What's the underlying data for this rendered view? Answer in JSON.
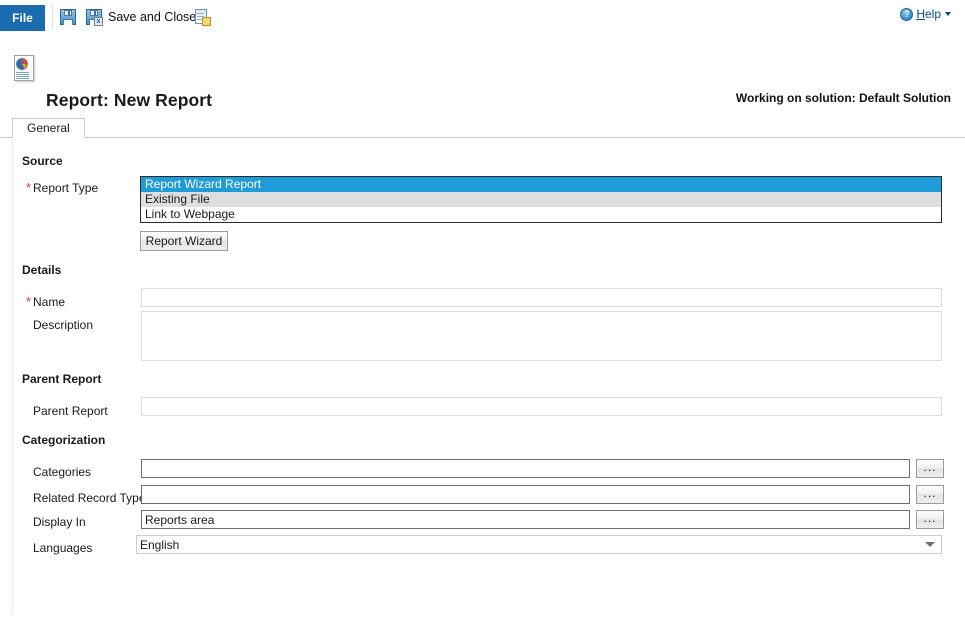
{
  "commandbar": {
    "file_tab": "File",
    "save_icon": "save-icon",
    "save_and_close_icon": "save-and-close-icon",
    "save_and_close_label": "Save and Close",
    "new_icon": "save-and-new-icon",
    "help": {
      "icon": "help-icon",
      "accel": "H",
      "rest": "elp",
      "caret": "chevron-down-icon"
    }
  },
  "header": {
    "icon": "report-document-icon",
    "title": "Report: New Report",
    "solution": "Working on solution: Default Solution"
  },
  "tabs": [
    {
      "label": "General",
      "selected": true
    }
  ],
  "sections": {
    "source": {
      "heading": "Source",
      "report_type": {
        "label": "Report Type",
        "required": true,
        "required_marker": "*",
        "options": [
          {
            "label": "Report Wizard Report",
            "selected": true
          },
          {
            "label": "Existing File",
            "selected": false
          },
          {
            "label": "Link to Webpage",
            "selected": false
          }
        ]
      },
      "report_wizard_button": "Report Wizard"
    },
    "details": {
      "heading": "Details",
      "name": {
        "label": "Name",
        "required": true,
        "required_marker": "*",
        "value": "",
        "placeholder": ""
      },
      "description": {
        "label": "Description",
        "required": false,
        "value": "",
        "placeholder": ""
      }
    },
    "parent_report": {
      "heading": "Parent Report",
      "field": {
        "label": "Parent Report",
        "value": "",
        "placeholder": "",
        "lookup_icon": "magnifier-lookup-icon"
      }
    },
    "categorization": {
      "heading": "Categorization",
      "categories": {
        "label": "Categories",
        "value": "",
        "placeholder": "",
        "browse_label": "..."
      },
      "related_record_types": {
        "label": "Related Record Types",
        "value": "",
        "placeholder": "",
        "browse_label": "..."
      },
      "display_in": {
        "label": "Display In",
        "value": "Reports area",
        "placeholder": "",
        "browse_label": "..."
      },
      "languages": {
        "label": "Languages",
        "value": "English",
        "chevron": "chevron-down-icon"
      }
    }
  },
  "colors": {
    "file_tab_blue": "#1a6bb0",
    "selection_blue": "#1f9bd8",
    "alt_row_gray": "#dedede",
    "required_red": "#d8402f",
    "help_link": "#0a4a80"
  }
}
